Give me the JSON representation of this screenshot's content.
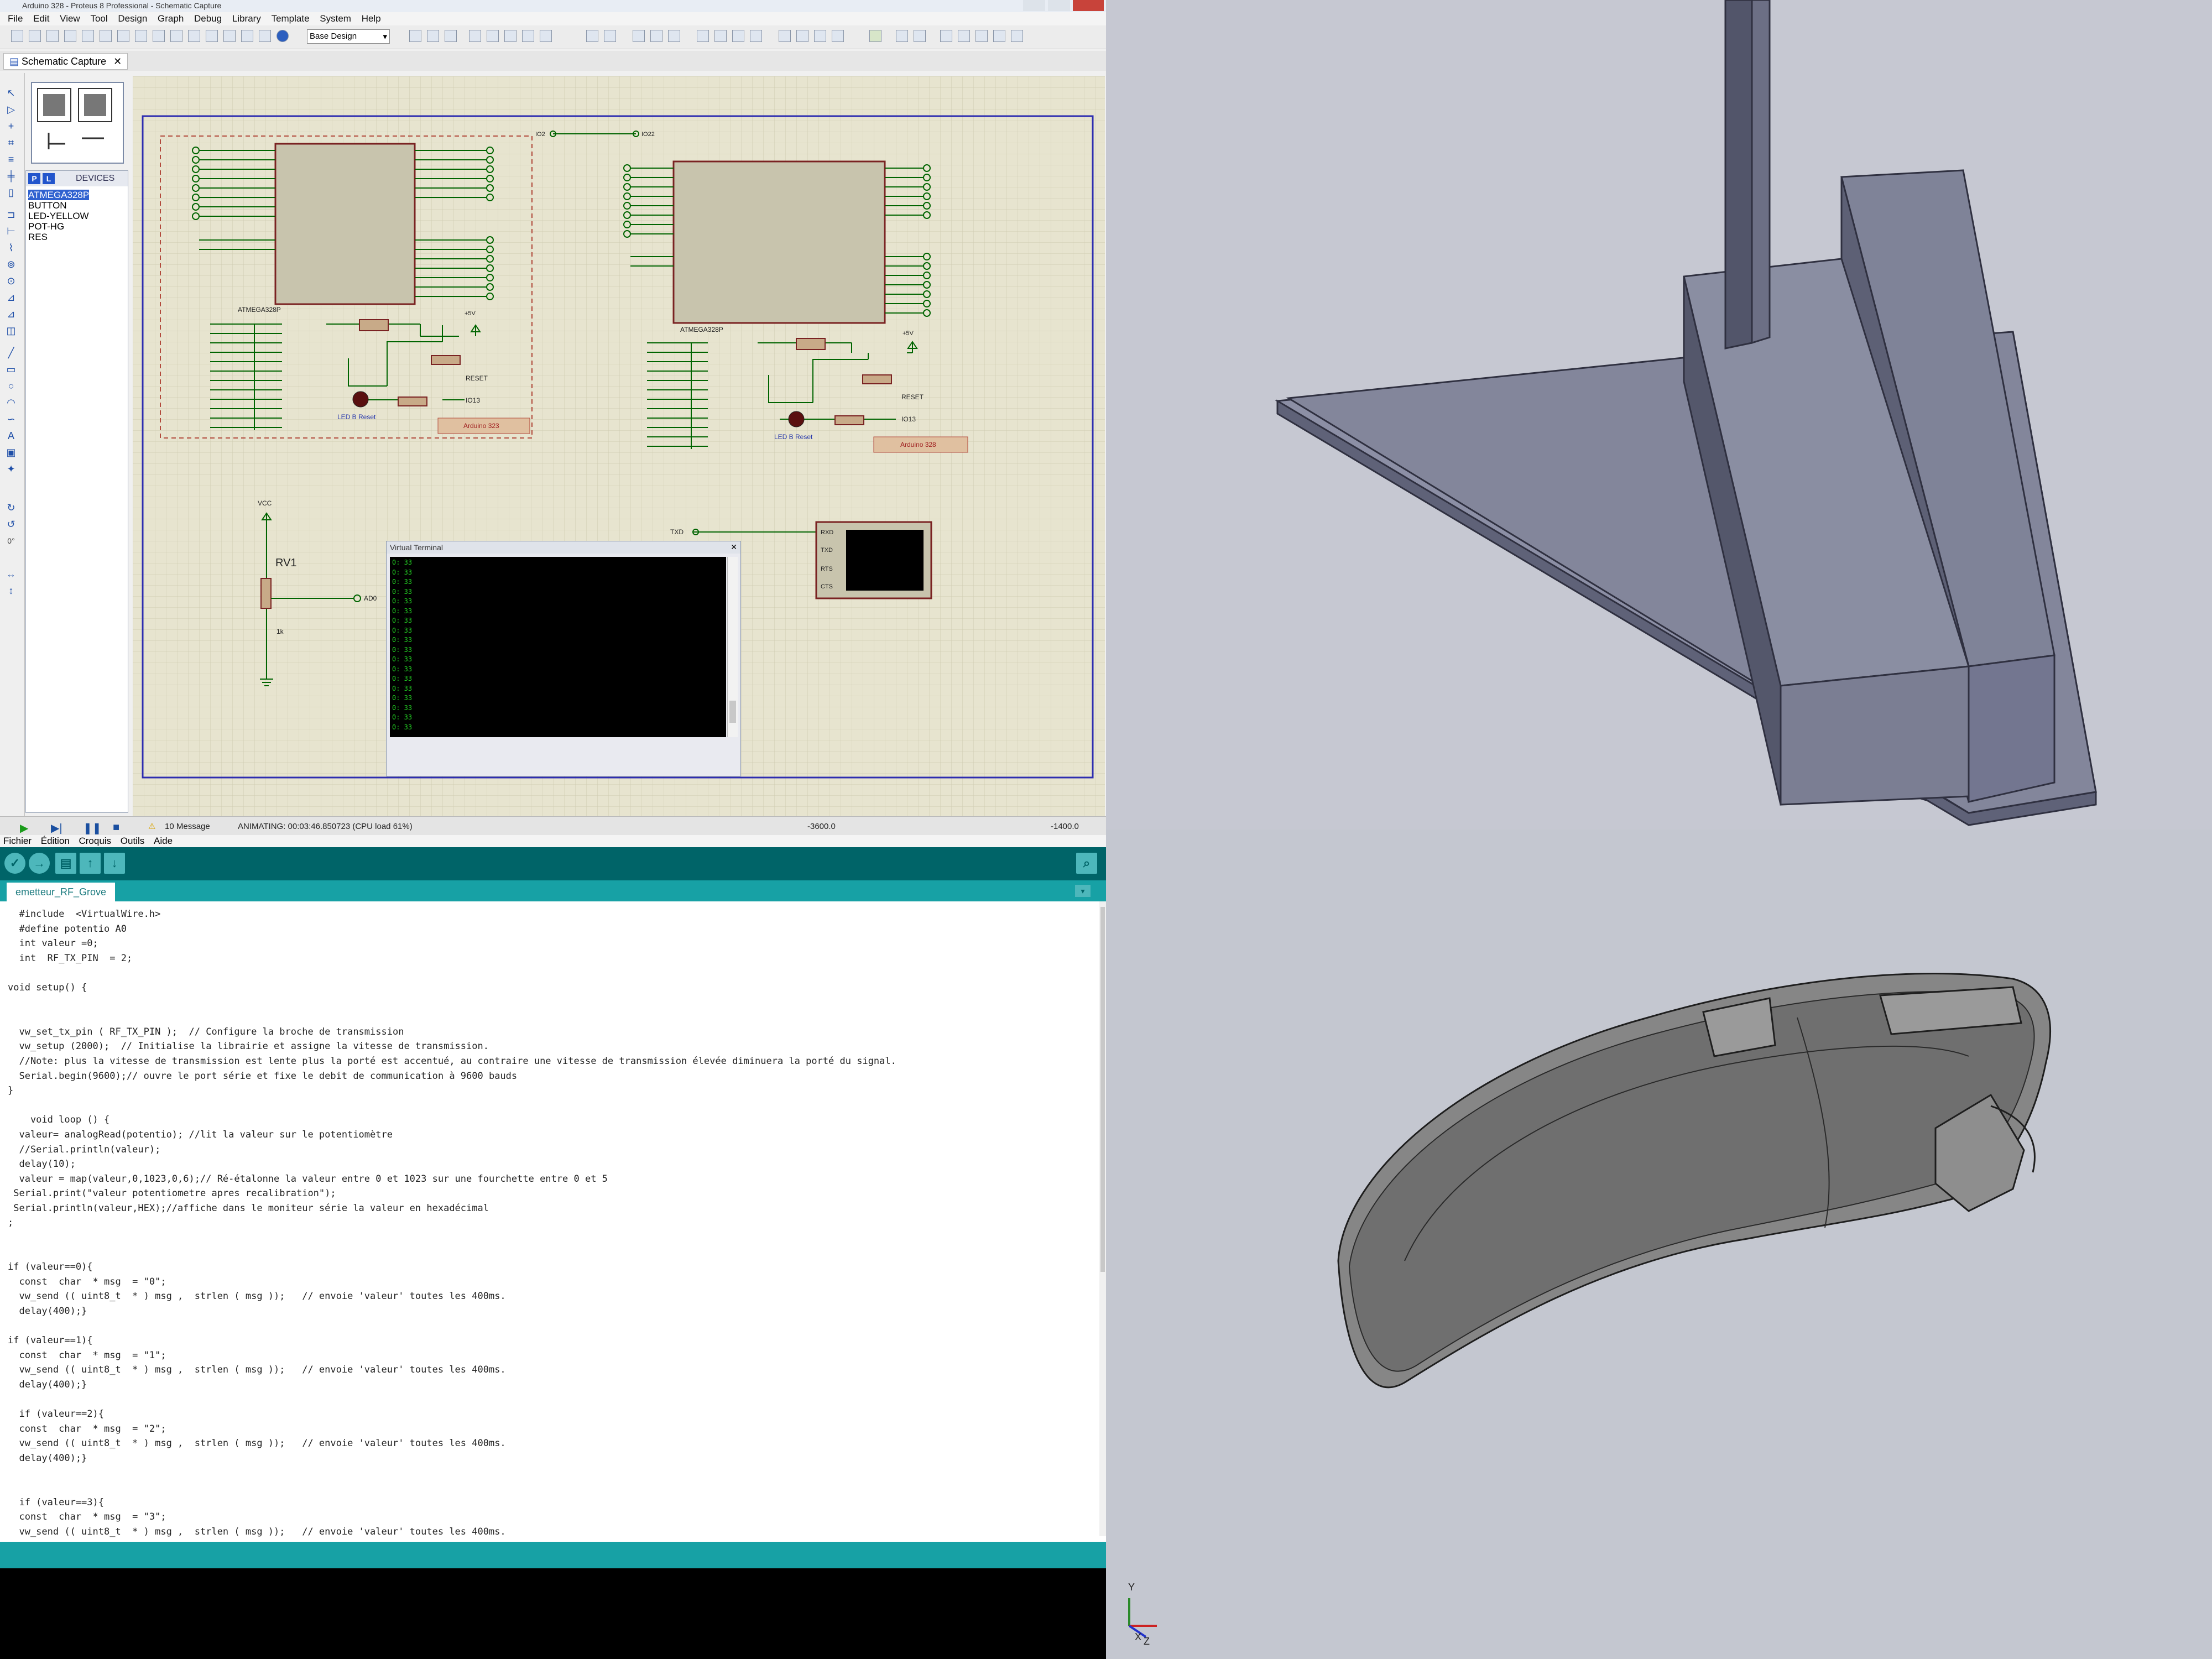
{
  "proteus": {
    "title": "Arduino 328 - Proteus 8 Professional - Schematic Capture",
    "menu": [
      "File",
      "Edit",
      "View",
      "Tool",
      "Design",
      "Graph",
      "Debug",
      "Library",
      "Template",
      "System",
      "Help"
    ],
    "design_select": "Base Design",
    "tab_label": "Schematic Capture",
    "devices_header": "DEVICES",
    "devices": [
      "ATMEGA328P",
      "BUTTON",
      "LED-YELLOW",
      "POT-HG",
      "RES"
    ],
    "schematic": {
      "chip1_label": "ATMEGA328P",
      "chip2_label": "ATMEGA328P",
      "board1_label": "Arduino 323",
      "board2_label": "Arduino 328",
      "led_reset_label": "LED B Reset",
      "vcc_label": "VCC",
      "pot_label": "RV1",
      "pot_value": "1k",
      "pot_out": "AD0",
      "io_net_left": "IO2",
      "io_net_right": "IO22",
      "reset_net": "RESET",
      "io13_net": "IO13",
      "plus5v": "+5V",
      "txd_net": "TXD",
      "terminal_pins": [
        "RXD",
        "TXD",
        "RTS",
        "CTS"
      ],
      "virtual_terminal_title": "Virtual Terminal",
      "terminal_lines": [
        "0: 33",
        "0: 33",
        "0: 33",
        "0: 33",
        "0: 33",
        "0: 33",
        "0: 33",
        "0: 33",
        "0: 33",
        "0: 33",
        "0: 33",
        "0: 33",
        "0: 33",
        "0: 33",
        "0: 33",
        "0: 33",
        "0: 33",
        "0: 33"
      ]
    },
    "status": {
      "messages": "10 Message",
      "animating": "ANIMATING: 00:03:46.850723 (CPU load 61%)",
      "coord_x": "-3600.0",
      "coord_y": "-1400.0"
    }
  },
  "arduino": {
    "menu": [
      "Fichier",
      "Édition",
      "Croquis",
      "Outils",
      "Aide"
    ],
    "tab_label": "emetteur_RF_Grove",
    "code": "  #include  <VirtualWire.h>\n  #define potentio A0\n  int valeur =0;\n  int  RF_TX_PIN  = 2;\n\nvoid setup() {\n\n\n  vw_set_tx_pin ( RF_TX_PIN );  // Configure la broche de transmission\n  vw_setup (2000);  // Initialise la librairie et assigne la vitesse de transmission.\n  //Note: plus la vitesse de transmission est lente plus la porté est accentué, au contraire une vitesse de transmission élevée diminuera la porté du signal.\n  Serial.begin(9600);// ouvre le port série et fixe le debit de communication à 9600 bauds\n}\n\n    void loop () {\n  valeur= analogRead(potentio); //lit la valeur sur le potentiomètre\n  //Serial.println(valeur);\n  delay(10);\n  valeur = map(valeur,0,1023,0,6);// Ré-étalonne la valeur entre 0 et 1023 sur une fourchette entre 0 et 5\n Serial.print(\"valeur potentiometre apres recalibration\");\n Serial.println(valeur,HEX);//affiche dans le moniteur série la valeur en hexadécimal\n;\n\n\nif (valeur==0){\n  const  char  * msg  = \"0\";\n  vw_send (( uint8_t  * ) msg ,  strlen ( msg ));   // envoie 'valeur' toutes les 400ms.\n  delay(400);}\n\nif (valeur==1){\n  const  char  * msg  = \"1\";\n  vw_send (( uint8_t  * ) msg ,  strlen ( msg ));   // envoie 'valeur' toutes les 400ms.\n  delay(400);}\n\n  if (valeur==2){\n  const  char  * msg  = \"2\";\n  vw_send (( uint8_t  * ) msg ,  strlen ( msg ));   // envoie 'valeur' toutes les 400ms.\n  delay(400);}\n\n\n  if (valeur==3){\n  const  char  * msg  = \"3\";\n  vw_send (( uint8_t  * ) msg ,  strlen ( msg ));   // envoie 'valeur' toutes les 400ms."
  },
  "cad": {
    "axis_y": "Y",
    "axis_x": "X",
    "axis_z": "Z"
  },
  "colors": {
    "proteus_canvas": "#e7e4cf",
    "proteus_wire": "#006400",
    "proteus_part": "#c8c4ad",
    "proteus_part_border": "#7a2222",
    "arduino_teal_dark": "#006468",
    "arduino_teal": "#17a1a5",
    "cad_background": "#c4c7d0",
    "cad_part_top": "#8a8ea2",
    "cad_part_side": "#5e6176"
  }
}
